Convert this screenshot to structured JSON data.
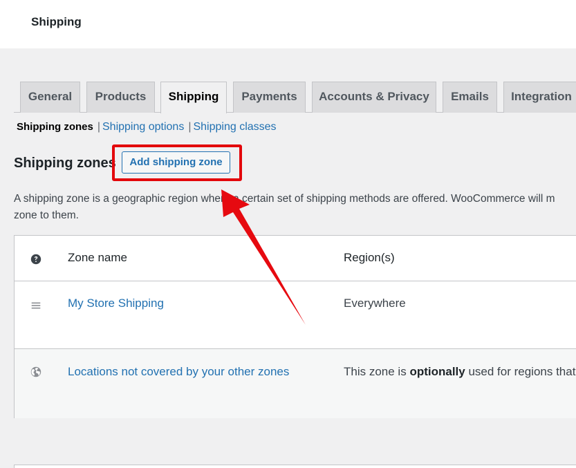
{
  "header": {
    "title": "Shipping"
  },
  "tabs": [
    {
      "label": "General"
    },
    {
      "label": "Products"
    },
    {
      "label": "Shipping"
    },
    {
      "label": "Payments"
    },
    {
      "label": "Accounts & Privacy"
    },
    {
      "label": "Emails"
    },
    {
      "label": "Integration"
    }
  ],
  "subnav": {
    "current": "Shipping zones",
    "separator": "|",
    "links": [
      {
        "label": "Shipping options"
      },
      {
        "label": "Shipping classes"
      }
    ]
  },
  "section": {
    "title": "Shipping zones",
    "add_button": "Add shipping zone",
    "description_line1": "A shipping zone is a geographic region where a certain set of shipping methods are offered. WooCommerce will m",
    "description_line2": "zone to them."
  },
  "table": {
    "columns": {
      "name": "Zone name",
      "regions": "Region(s)"
    },
    "rows": [
      {
        "name": "My Store Shipping",
        "regions": "Everywhere"
      }
    ],
    "rest_of_world": {
      "name": "Locations not covered by your other zones",
      "regions_pre": "This zone is ",
      "regions_bold": "optionally",
      "regions_post": " used for regions that"
    }
  },
  "colors": {
    "accent": "#2271b1",
    "highlight": "#e3060b"
  },
  "icons": {
    "help": "help-icon",
    "drag": "drag-handle-icon",
    "globe": "globe-icon"
  }
}
